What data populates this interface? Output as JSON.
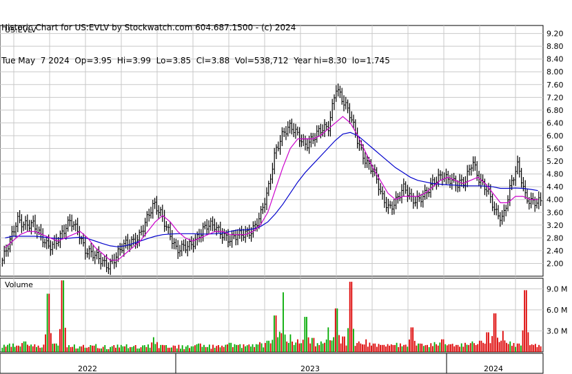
{
  "header": {
    "line1": "Historic Chart for US:EVLV by Stockwatch.com 604.687.1500 - (c) 2024",
    "line2": "Tue May  7 2024  Op=3.95  Hi=3.99  Lo=3.85  Cl=3.88  Vol=538,712  Year hi=8.30  lo=1.745"
  },
  "chart_data": {
    "type": "line",
    "ticker_label": "US:EVLV",
    "volume_label": "Volume",
    "price_ticks": [
      "9.20",
      "8.80",
      "8.40",
      "8.00",
      "7.60",
      "7.20",
      "6.80",
      "6.40",
      "6.00",
      "5.60",
      "5.20",
      "4.80",
      "4.40",
      "4.00",
      "3.60",
      "3.20",
      "2.80",
      "2.40",
      "2.00"
    ],
    "volume_ticks": [
      "9.0 M",
      "6.0 M",
      "3.0 M"
    ],
    "x_labels": [
      "2022",
      "2023",
      "2024"
    ],
    "ylim": [
      1.6,
      9.45
    ],
    "vol_lim": [
      0,
      10.5
    ],
    "grid": true,
    "colors": {
      "up": "#00aa00",
      "down": "#dd0000",
      "bar": "#000000",
      "ma_short": "#cc00cc",
      "ma_long": "#0000cc",
      "grid": "#c8c8c8"
    },
    "series": [
      {
        "role": "close_bars",
        "values": [
          2.1,
          2.6,
          3.4,
          3.3,
          3.2,
          2.8,
          2.6,
          2.7,
          2.9,
          3.3,
          3.1,
          2.4,
          2.2,
          2.1,
          2.0,
          2.2,
          2.5,
          2.7,
          2.9,
          3.3,
          3.8,
          3.6,
          3.0,
          2.3,
          2.5,
          2.7,
          2.9,
          3.1,
          3.2,
          3.0,
          2.7,
          2.8,
          3.0,
          3.1,
          3.4,
          4.2,
          5.6,
          6.1,
          6.2,
          6.0,
          5.8,
          5.9,
          6.1,
          6.3,
          7.6,
          7.0,
          6.5,
          5.8,
          5.2,
          4.8,
          4.1,
          3.8,
          4.0,
          4.3,
          4.0,
          4.1,
          4.2,
          4.5,
          4.8,
          4.7,
          4.4,
          4.5,
          5.3,
          4.6,
          4.2,
          3.6,
          3.5,
          4.4,
          5.0,
          4.1,
          4.0,
          3.9
        ]
      },
      {
        "role": "ma_short",
        "values": [
          2.5,
          2.7,
          2.9,
          3.0,
          3.0,
          2.9,
          2.8,
          2.7,
          2.8,
          2.9,
          3.0,
          2.8,
          2.5,
          2.3,
          2.1,
          2.1,
          2.3,
          2.5,
          2.7,
          3.0,
          3.3,
          3.5,
          3.3,
          3.0,
          2.8,
          2.7,
          2.8,
          2.9,
          3.0,
          3.0,
          2.9,
          2.9,
          2.9,
          3.0,
          3.2,
          3.6,
          4.3,
          5.0,
          5.6,
          5.9,
          5.9,
          5.9,
          6.0,
          6.2,
          6.4,
          6.6,
          6.4,
          6.0,
          5.5,
          5.0,
          4.6,
          4.2,
          4.0,
          4.1,
          4.1,
          4.1,
          4.2,
          4.4,
          4.6,
          4.7,
          4.6,
          4.5,
          4.6,
          4.7,
          4.5,
          4.2,
          3.9,
          3.9,
          4.1,
          4.1,
          4.0,
          4.0
        ]
      },
      {
        "role": "ma_long",
        "values": [
          2.8,
          2.85,
          2.85,
          2.85,
          2.85,
          2.83,
          2.8,
          2.78,
          2.78,
          2.8,
          2.82,
          2.78,
          2.7,
          2.62,
          2.55,
          2.52,
          2.55,
          2.62,
          2.7,
          2.78,
          2.85,
          2.9,
          2.92,
          2.93,
          2.93,
          2.93,
          2.92,
          2.92,
          2.93,
          2.95,
          3.0,
          3.05,
          3.05,
          3.08,
          3.15,
          3.3,
          3.55,
          3.85,
          4.2,
          4.55,
          4.85,
          5.1,
          5.35,
          5.6,
          5.85,
          6.05,
          6.1,
          6.0,
          5.8,
          5.6,
          5.4,
          5.2,
          5.0,
          4.85,
          4.7,
          4.6,
          4.55,
          4.5,
          4.48,
          4.46,
          4.45,
          4.43,
          4.43,
          4.43,
          4.42,
          4.4,
          4.35,
          4.35,
          4.36,
          4.35,
          4.32,
          4.28
        ]
      },
      {
        "role": "volume",
        "values": [
          0.6,
          1.2,
          0.9,
          1.5,
          0.8,
          0.6,
          8.3,
          1.2,
          10.2,
          0.7,
          0.5,
          0.6,
          0.9,
          0.5,
          0.4,
          0.6,
          0.8,
          0.7,
          0.5,
          0.7,
          2.1,
          1.0,
          0.6,
          0.5,
          0.4,
          0.8,
          1.2,
          0.7,
          0.6,
          0.9,
          1.3,
          1.0,
          0.8,
          1.1,
          1.4,
          1.6,
          5.2,
          8.5,
          2.5,
          1.8,
          5.0,
          2.0,
          1.5,
          3.5,
          6.2,
          2.2,
          10.0,
          1.5,
          1.8,
          1.2,
          1.0,
          0.9,
          1.3,
          1.0,
          3.5,
          1.2,
          1.0,
          1.4,
          1.8,
          1.1,
          1.0,
          1.3,
          1.5,
          1.6,
          2.8,
          5.5,
          3.0,
          1.5,
          1.2,
          8.8,
          1.0,
          0.8
        ],
        "up": [
          1,
          1,
          0,
          1,
          0,
          0,
          0,
          1,
          0,
          0,
          1,
          0,
          0,
          0,
          1,
          0,
          1,
          1,
          1,
          1,
          1,
          0,
          0,
          0,
          1,
          1,
          1,
          1,
          0,
          0,
          1,
          1,
          1,
          1,
          1,
          1,
          1,
          1,
          1,
          0,
          1,
          0,
          1,
          1,
          1,
          0,
          1,
          0,
          0,
          0,
          0,
          0,
          1,
          1,
          0,
          1,
          1,
          1,
          1,
          0,
          0,
          1,
          1,
          0,
          0,
          0,
          0,
          1,
          1,
          0,
          0,
          0
        ]
      }
    ]
  }
}
